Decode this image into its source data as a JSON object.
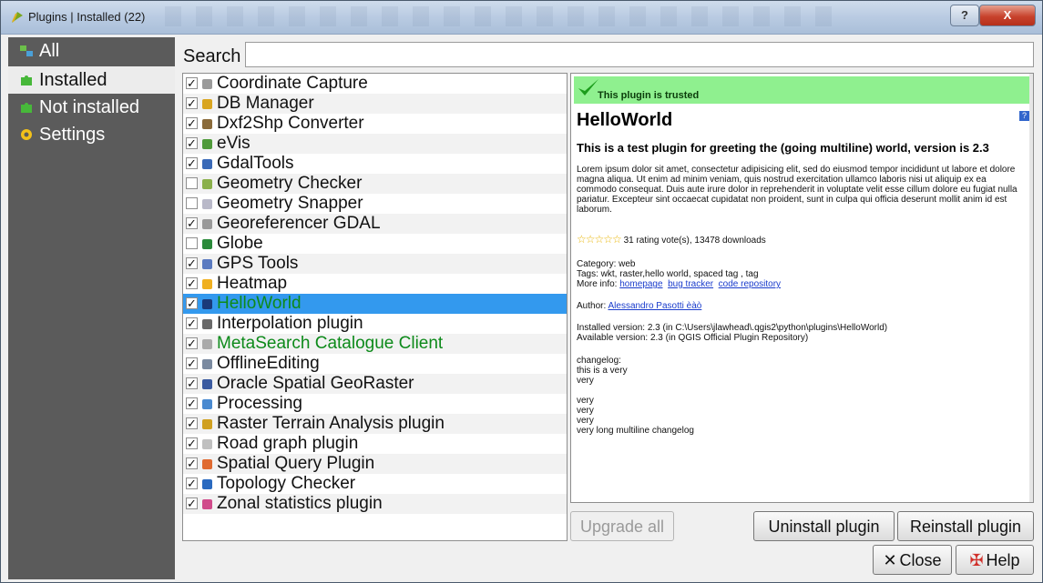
{
  "window": {
    "title": "Plugins | Installed (22)",
    "help_button": "?",
    "close_button": "X"
  },
  "sidebar": {
    "items": [
      {
        "label": "All",
        "icon": "all-plugins-icon"
      },
      {
        "label": "Installed",
        "icon": "installed-puzzle-icon",
        "active": true
      },
      {
        "label": "Not installed",
        "icon": "not-installed-puzzle-icon"
      },
      {
        "label": "Settings",
        "icon": "gear-icon"
      }
    ]
  },
  "search": {
    "label": "Search",
    "value": ""
  },
  "plugins": [
    {
      "name": "Coordinate Capture",
      "checked": true,
      "icon": "crosshair-icon"
    },
    {
      "name": "DB Manager",
      "checked": true,
      "icon": "database-icon"
    },
    {
      "name": "Dxf2Shp Converter",
      "checked": true,
      "icon": "dxf-icon"
    },
    {
      "name": "eVis",
      "checked": true,
      "icon": "evis-icon"
    },
    {
      "name": "GdalTools",
      "checked": true,
      "icon": "gdal-icon"
    },
    {
      "name": "Geometry Checker",
      "checked": false,
      "icon": "geometry-checker-icon"
    },
    {
      "name": "Geometry Snapper",
      "checked": false,
      "icon": "snapper-icon"
    },
    {
      "name": "Georeferencer GDAL",
      "checked": true,
      "icon": "grid-icon"
    },
    {
      "name": "Globe",
      "checked": false,
      "icon": "globe-icon"
    },
    {
      "name": "GPS Tools",
      "checked": true,
      "icon": "gps-icon"
    },
    {
      "name": "Heatmap",
      "checked": true,
      "icon": "heatmap-icon"
    },
    {
      "name": "HelloWorld",
      "checked": true,
      "icon": "person-icon",
      "selected": true,
      "green": true
    },
    {
      "name": "Interpolation plugin",
      "checked": true,
      "icon": "interpolation-icon"
    },
    {
      "name": "MetaSearch Catalogue Client",
      "checked": true,
      "icon": "csw-icon",
      "green": true
    },
    {
      "name": "OfflineEditing",
      "checked": true,
      "icon": "offline-icon"
    },
    {
      "name": "Oracle Spatial GeoRaster",
      "checked": true,
      "icon": "oracle-icon"
    },
    {
      "name": "Processing",
      "checked": true,
      "icon": "processing-icon"
    },
    {
      "name": "Raster Terrain Analysis plugin",
      "checked": true,
      "icon": "terrain-icon"
    },
    {
      "name": "Road graph plugin",
      "checked": true,
      "icon": "road-graph-icon"
    },
    {
      "name": "Spatial Query Plugin",
      "checked": true,
      "icon": "spatial-query-icon"
    },
    {
      "name": "Topology Checker",
      "checked": true,
      "icon": "topology-icon"
    },
    {
      "name": "Zonal statistics plugin",
      "checked": true,
      "icon": "zonal-icon"
    }
  ],
  "details": {
    "trusted": "This plugin is trusted",
    "title": "HelloWorld",
    "subtitle": "This is a test plugin for greeting the (going multiline) world, version is 2.3",
    "description": "Lorem ipsum dolor sit amet, consectetur adipisicing elit, sed do eiusmod tempor incididunt ut labore et dolore magna aliqua. Ut enim ad minim veniam, quis nostrud exercitation ullamco laboris nisi ut aliquip ex ea commodo consequat. Duis aute irure dolor in reprehenderit in voluptate velit esse cillum dolore eu fugiat nulla pariatur. Excepteur sint occaecat cupidatat non proident, sunt in culpa qui officia deserunt mollit anim id est laborum.",
    "stars": "☆☆☆☆☆",
    "rating": "31 rating vote(s), 13478 downloads",
    "category": "Category: web",
    "tags": "Tags: wkt, raster,hello world, spaced tag , tag",
    "more_info_label": "More info:",
    "links": [
      "homepage",
      "bug tracker",
      "code repository"
    ],
    "author_label": "Author:",
    "author": "Alessandro Pasotti èàò",
    "installed_version": "Installed version: 2.3 (in C:\\Users\\jlawhead\\.qgis2\\python\\plugins\\HelloWorld)",
    "available_version": "Available version: 2.3 (in QGIS Official Plugin Repository)",
    "changelog_label": "changelog:",
    "changelog_lines": [
      "this is a very",
      "very",
      "",
      "very",
      "very",
      "very",
      "very long multiline changelog"
    ]
  },
  "buttons": {
    "upgrade_all": "Upgrade all",
    "uninstall": "Uninstall plugin",
    "reinstall": "Reinstall plugin",
    "close": "Close",
    "help": "Help"
  },
  "colors": {
    "sidebar_bg": "#5b5b5b",
    "selection": "#3399ee",
    "trusted_green": "#8ff08f",
    "plugin_green_text": "#0d8a1a"
  }
}
